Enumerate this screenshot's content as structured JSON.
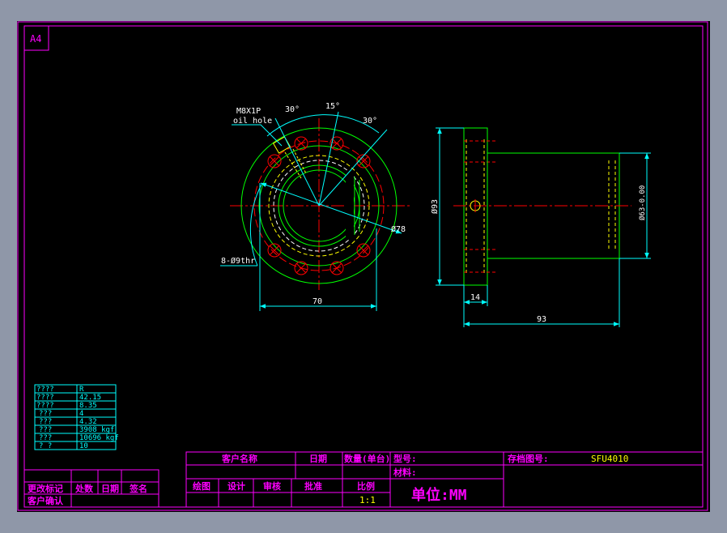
{
  "sheet": {
    "size_label": "A4"
  },
  "front_view": {
    "thread_label": "M8X1P",
    "oil_hole_label": "oil hole",
    "angle_left": "30°",
    "angle_top": "15°",
    "angle_right": "30°",
    "bolt_circle_dia": "Ø78",
    "holes_label": "8-Ø9thr",
    "width_dim": "70"
  },
  "side_view": {
    "flange_dia": "Ø93",
    "body_dia": "Ø63-0.00",
    "flange_thk": "14",
    "overall_len": "93"
  },
  "param_table": {
    "rows": [
      {
        "k": "????",
        "v": "R"
      },
      {
        "k": "????",
        "v": "42.15"
      },
      {
        "k": "????",
        "v": "8.35"
      },
      {
        "k": "???",
        "v": "4"
      },
      {
        "k": "???",
        "v": "4.32"
      },
      {
        "k": "???",
        "v": "3908 kgf"
      },
      {
        "k": "???",
        "v": "10696 kgf"
      },
      {
        "k": "?  ?",
        "v": "10"
      }
    ]
  },
  "title_block": {
    "customer_name": "客户名称",
    "date": "日期",
    "qty": "数量(单台)",
    "model": "型号:",
    "archive_no": "存档图号:",
    "archive_val": "SFU4010",
    "material": "材料:",
    "drawn": "绘图",
    "design": "设计",
    "review": "审核",
    "approve": "批准",
    "scale": "比例",
    "scale_val": "1:1",
    "unit": "单位:MM"
  },
  "revision_block": {
    "change_mark": "更改标记",
    "place": "处数",
    "date": "日期",
    "signature": "签名",
    "customer_confirm": "客户确认"
  },
  "colors": {
    "frame": "#ff00ff",
    "dim": "#00ffff",
    "outline": "#00ff00",
    "hidden": "#ffff00",
    "center": "#ff0000",
    "text_yellow": "#ffff00"
  }
}
